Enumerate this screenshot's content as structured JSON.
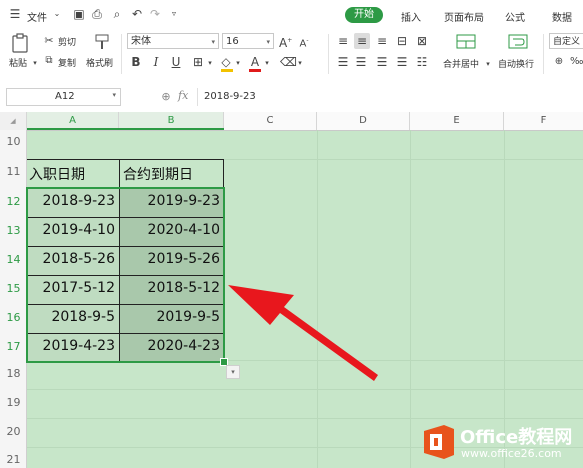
{
  "menu": {
    "file_label": "文件",
    "tabs": [
      "开始",
      "插入",
      "页面布局",
      "公式",
      "数据"
    ]
  },
  "ribbon": {
    "paste": "粘贴",
    "cut": "剪切",
    "copy": "复制",
    "format_painter": "格式刷",
    "font_name": "宋体",
    "font_size": "16",
    "merge_center": "合并居中",
    "wrap_text": "自动换行",
    "number_format": "自定义"
  },
  "formula_bar": {
    "cell_ref": "A12",
    "fx": "fx",
    "content": "2018-9-23"
  },
  "columns": [
    "A",
    "B",
    "C",
    "D",
    "E",
    "F"
  ],
  "rows": [
    "10",
    "11",
    "12",
    "13",
    "14",
    "15",
    "16",
    "17",
    "18",
    "19",
    "20",
    "21"
  ],
  "table": {
    "headers": [
      "入职日期",
      "合约到期日"
    ],
    "rows": [
      [
        "2018-9-23",
        "2019-9-23"
      ],
      [
        "2019-4-10",
        "2020-4-10"
      ],
      [
        "2018-5-26",
        "2019-5-26"
      ],
      [
        "2017-5-12",
        "2018-5-12"
      ],
      [
        "2018-9-5",
        "2019-9-5"
      ],
      [
        "2019-4-23",
        "2020-4-23"
      ]
    ]
  },
  "watermark": {
    "brand": "Office教程网",
    "url": "www.office26.com"
  },
  "colors": {
    "accent": "#2d9a45",
    "sheet_bg": "#c7e6c9",
    "selection_bg": "#a9c8ab",
    "arrow": "#e8171d",
    "logo": "#e8531c"
  }
}
